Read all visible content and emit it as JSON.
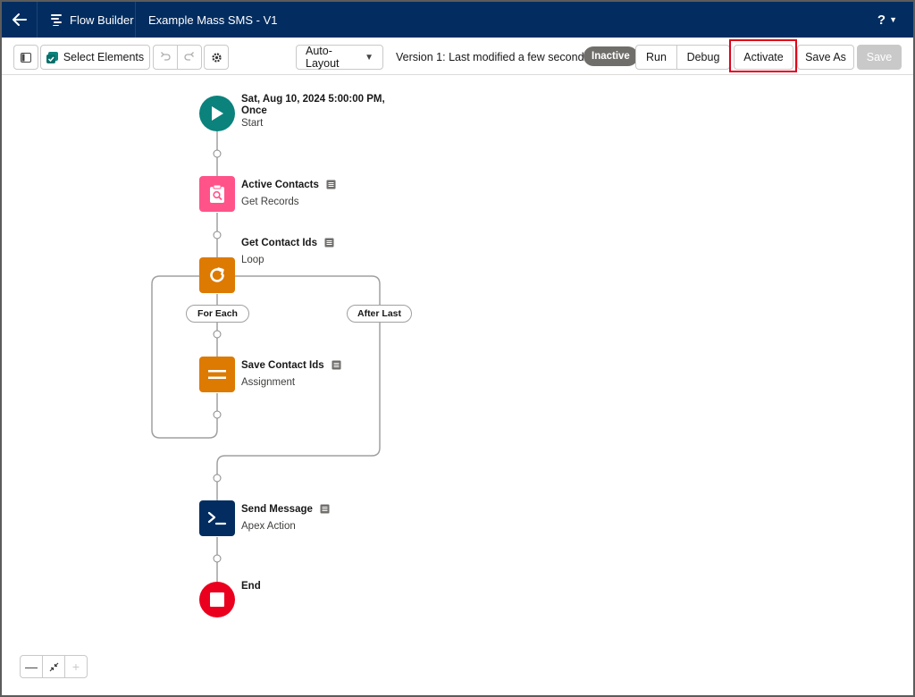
{
  "header": {
    "app_name": "Flow Builder",
    "flow_name": "Example Mass SMS - V1",
    "help_label": "?"
  },
  "toolbar": {
    "select_elements_label": "Select Elements",
    "layout_mode": "Auto-Layout",
    "version_text": "Version 1: Last modified a few seconds ago",
    "status_badge": "Inactive",
    "run_label": "Run",
    "debug_label": "Debug",
    "activate_label": "Activate",
    "save_as_label": "Save As",
    "save_label": "Save"
  },
  "flow": {
    "start": {
      "title_line1": "Sat, Aug 10, 2024 5:00:00 PM,",
      "title_line2": "Once",
      "type": "Start",
      "color": "#0b827c",
      "icon": "play-icon"
    },
    "get_records": {
      "title": "Active Contacts",
      "type": "Get Records",
      "color": "#ff538a",
      "icon": "clipboard-search-icon"
    },
    "loop": {
      "title": "Get Contact Ids",
      "type": "Loop",
      "color": "#dd7a01",
      "icon": "refresh-icon"
    },
    "for_each_label": "For Each",
    "after_last_label": "After Last",
    "assignment": {
      "title": "Save Contact Ids",
      "type": "Assignment",
      "color": "#dd7a01",
      "icon": "equals-icon"
    },
    "action": {
      "title": "Send Message",
      "type": "Apex Action",
      "color": "#032d60",
      "icon": "apex-icon"
    },
    "end": {
      "title": "End",
      "color": "#ea001e",
      "icon": "stop-icon"
    }
  },
  "zoom": {
    "zoom_out": "—",
    "fit": "fit-icon",
    "zoom_in": "+"
  }
}
